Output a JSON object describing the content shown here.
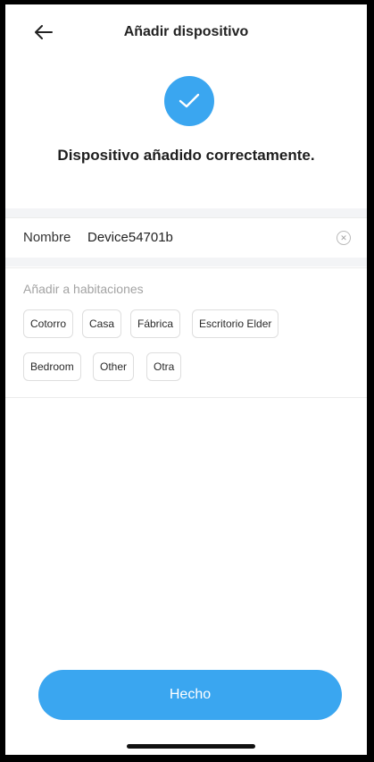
{
  "header": {
    "title": "Añadir dispositivo",
    "back_icon": "arrow-left-icon"
  },
  "status": {
    "icon": "checkmark-icon",
    "message": "Dispositivo añadido correctamente."
  },
  "name_field": {
    "label": "Nombre",
    "value": "Device54701b",
    "clear_icon": "clear-circle-icon"
  },
  "rooms": {
    "label": "Añadir a habitaciones",
    "items": [
      "Cotorro",
      "Casa",
      "Fábrica",
      "Escritorio Elder",
      "Bedroom",
      "Other",
      "Otra"
    ]
  },
  "done_button": {
    "label": "Hecho"
  },
  "colors": {
    "accent": "#3aa6f0",
    "background": "#ffffff",
    "divider": "#f3f4f6"
  }
}
